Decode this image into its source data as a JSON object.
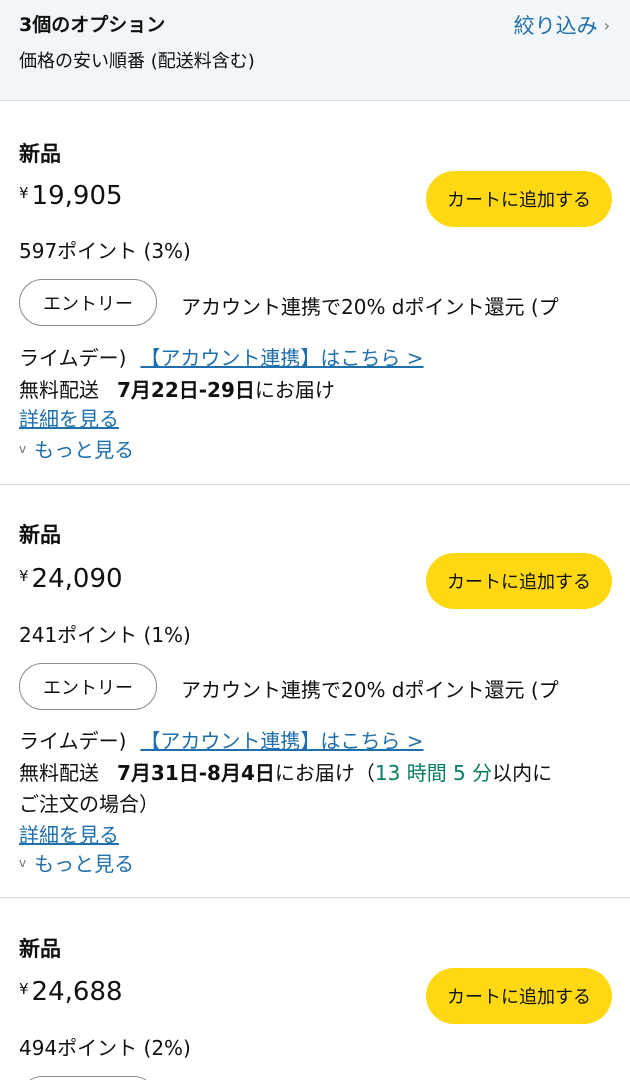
{
  "header": {
    "count_label": "3個のオプション",
    "sort_label": "価格の安い順番 (配送料含む)",
    "filter_label": "絞り込み",
    "filter_icon": "chevron-right-icon"
  },
  "offers": [
    {
      "condition": "新品",
      "currency": "¥",
      "price": "19,905",
      "points": "597ポイント (3%)",
      "cart_label": "カートに追加する",
      "entry_label": "エントリー",
      "promo_line1": "アカウント連携で20% dポイント還元 (プ",
      "promo_line2": "ライムデー)",
      "promo_link": "【アカウント連携】はこちら >",
      "shipping_label": "無料配送",
      "delivery_date": "7月22日-29日",
      "delivery_suffix": "にお届け",
      "details_label": "詳細を見る",
      "more_label": "もっと見る"
    },
    {
      "condition": "新品",
      "currency": "¥",
      "price": "24,090",
      "points": "241ポイント (1%)",
      "cart_label": "カートに追加する",
      "entry_label": "エントリー",
      "promo_line1": "アカウント連携で20% dポイント還元 (プ",
      "promo_line2": "ライムデー)",
      "promo_link": "【アカウント連携】はこちら >",
      "shipping_label": "無料配送",
      "delivery_date": "7月31日-8月4日",
      "delivery_suffix": "にお届け（",
      "countdown": "13 時間 5 分",
      "countdown_suffix": "以内に",
      "delivery_line2": "ご注文の場合）",
      "details_label": "詳細を見る",
      "more_label": "もっと見る"
    },
    {
      "condition": "新品",
      "currency": "¥",
      "price": "24,688",
      "points": "494ポイント (2%)",
      "cart_label": "カートに追加する"
    }
  ],
  "colors": {
    "link": "#1f6fad",
    "cart_button": "#ffd814",
    "countdown": "#067d62",
    "header_bg": "#f3f6f9"
  }
}
